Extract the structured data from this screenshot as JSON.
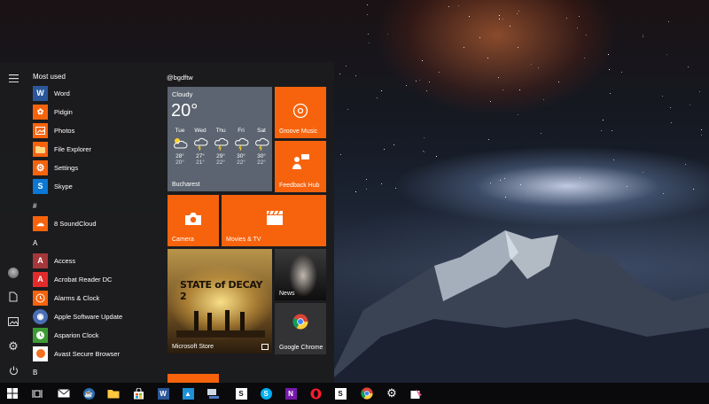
{
  "start_menu": {
    "most_used_heading": "Most used",
    "hash_heading": "#",
    "a_heading": "A",
    "b_heading": "B",
    "user_label": "@bgdftw",
    "most_used": [
      {
        "label": "Word",
        "icon": "word-icon",
        "color": "#2b579a",
        "glyph": "W"
      },
      {
        "label": "Pidgin",
        "icon": "pidgin-icon",
        "color": "#f7630c",
        "glyph": "P"
      },
      {
        "label": "Photos",
        "icon": "photos-icon",
        "color": "#f7630c",
        "glyph": "▣"
      },
      {
        "label": "File Explorer",
        "icon": "folder-icon",
        "color": "#f7630c",
        "glyph": "▬"
      },
      {
        "label": "Settings",
        "icon": "gear-icon",
        "color": "#f7630c",
        "glyph": "⚙"
      },
      {
        "label": "Skype",
        "icon": "skype-icon",
        "color": "#0a78d4",
        "glyph": "S"
      }
    ],
    "hash_apps": [
      {
        "label": "8 SoundCloud",
        "icon": "soundcloud-icon",
        "color": "#f7630c",
        "glyph": "☁"
      }
    ],
    "a_apps": [
      {
        "label": "Access",
        "icon": "access-icon",
        "color": "#a4373a",
        "glyph": "A"
      },
      {
        "label": "Acrobat Reader DC",
        "icon": "acrobat-icon",
        "color": "#e22b2b",
        "glyph": "A"
      },
      {
        "label": "Alarms & Clock",
        "icon": "clock-icon",
        "color": "#f7630c",
        "glyph": "◷"
      },
      {
        "label": "Apple Software Update",
        "icon": "apple-update-icon",
        "color": "#4a6fb5",
        "glyph": "◉"
      },
      {
        "label": "Asparion Clock",
        "icon": "asparion-clock-icon",
        "color": "#3d9b35",
        "glyph": "◔"
      },
      {
        "label": "Avast Secure Browser",
        "icon": "avast-icon",
        "color": "#ffffff",
        "glyph": "●"
      }
    ]
  },
  "tiles": {
    "weather": {
      "condition": "Cloudy",
      "temp": "20°",
      "city": "Bucharest",
      "days": [
        {
          "day": "Tue",
          "hi": "28°",
          "lo": "20°",
          "icon": "sun-cloud"
        },
        {
          "day": "Wed",
          "hi": "27°",
          "lo": "21°",
          "icon": "storm"
        },
        {
          "day": "Thu",
          "hi": "29°",
          "lo": "22°",
          "icon": "storm"
        },
        {
          "day": "Fri",
          "hi": "30°",
          "lo": "22°",
          "icon": "storm"
        },
        {
          "day": "Sat",
          "hi": "30°",
          "lo": "22°",
          "icon": "storm"
        }
      ]
    },
    "groove": "Groove Music",
    "feedback": "Feedback Hub",
    "camera": "Camera",
    "movies": "Movies & TV",
    "store": "Microsoft Store",
    "game_title": "STATE of DECAY 2",
    "news": "News",
    "chrome": "Google Chrome"
  },
  "taskbar_icons": [
    "start-icon",
    "task-view-icon",
    "mail-icon",
    "cup-icon",
    "file-explorer-icon",
    "store-icon",
    "word-icon",
    "photo-app-icon",
    "network-icon",
    "s-app-icon",
    "skype-icon",
    "onenote-icon",
    "opera-icon",
    "s-app-icon-2",
    "chrome-icon",
    "settings-icon",
    "snip-icon"
  ],
  "colors": {
    "accent": "#f7630c",
    "menu_bg": "#1c1c1e",
    "taskbar_bg": "#0a0a0c",
    "weather_tile": "#5b6470"
  }
}
